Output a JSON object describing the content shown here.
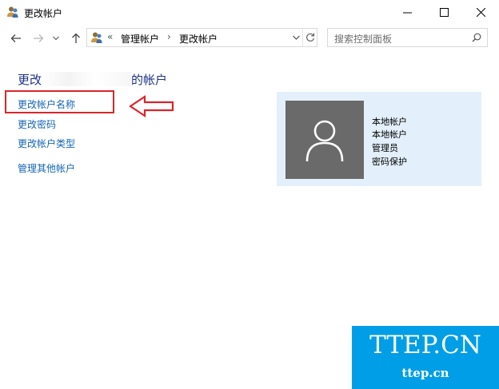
{
  "window": {
    "title": "更改帐户",
    "minimize_icon": "minimize-icon",
    "maximize_icon": "maximize-icon",
    "close_icon": "close-icon"
  },
  "nav": {
    "back_icon": "back-arrow-icon",
    "forward_icon": "forward-arrow-icon",
    "recent_icon": "chevron-down-icon",
    "up_icon": "up-arrow-icon"
  },
  "address": {
    "overflow": "«",
    "crumb1": "管理帐户",
    "separator": "›",
    "crumb2": "更改帐户",
    "dropdown_icon": "chevron-down-icon",
    "refresh_icon": "refresh-icon"
  },
  "search": {
    "placeholder": "搜索控制面板",
    "icon": "search-icon"
  },
  "content": {
    "heading_prefix": "更改",
    "heading_suffix": "的帐户",
    "links": [
      "更改帐户名称",
      "更改密码",
      "更改帐户类型",
      "管理其他帐户"
    ]
  },
  "account": {
    "lines": [
      "本地帐户",
      "本地帐户",
      "管理员",
      "密码保护"
    ],
    "avatar_icon": "user-avatar-icon"
  },
  "annotation": {
    "color": "#d9262b"
  },
  "watermark": {
    "big": "TTEP.CN",
    "small": "ttep.cn",
    "bg_color": "#009ee6"
  }
}
